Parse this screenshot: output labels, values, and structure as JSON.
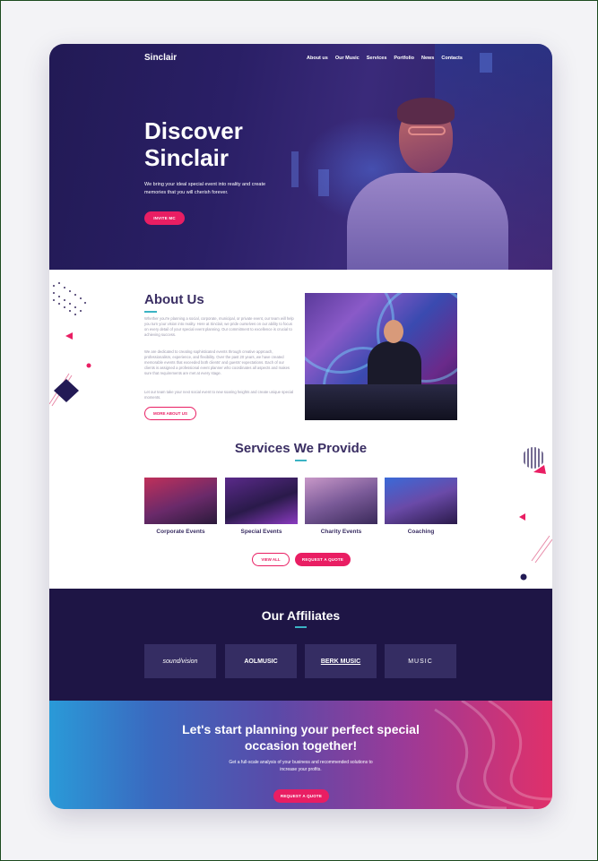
{
  "brand": "Sinclair",
  "nav": [
    "About us",
    "Our Music",
    "Services",
    "Portfolio",
    "News",
    "Contacts"
  ],
  "hero": {
    "title_line1": "Discover",
    "title_line2": "Sinclair",
    "subtitle": "We bring your ideal special event into reality and create memories that you will cherish forever.",
    "cta": "INVITE MC"
  },
  "about": {
    "title": "About Us",
    "para1": "Whether you're planning a social, corporate, municipal, or private event, our team will help you turn your vision into reality. Here at Sinclair, we pride ourselves on our ability to focus on every detail of your special event planning. Our commitment to excellence is crucial to achieving success.",
    "para2": "We are dedicated to creating sophisticated events through creative approach, professionalism, experience, and flexibility. Over the past 20 years, we have created memorable events that exceeded both clients' and guests' expectations. Each of our clients is assigned a professional event planner who coordinates all aspects and makes sure that requirements are met at every stage.",
    "para3": "Let our team take your next social event to new soaring heights and create unique special moments.",
    "button": "MORE ABOUT US"
  },
  "services": {
    "title": "Services We Provide",
    "items": [
      "Corporate Events",
      "Special Events",
      "Charity Events",
      "Coaching"
    ],
    "view_all": "VIEW ALL",
    "request": "REQUEST A QUOTE"
  },
  "affiliates": {
    "title": "Our Affiliates",
    "logos": [
      "sound/vision",
      "AOLMUSIC",
      "BERK MUSIC",
      "MUSIC"
    ]
  },
  "cta": {
    "title_line1": "Let's start planning your perfect special",
    "title_line2": "occasion together!",
    "subtitle": "Get a full-scale analysis of your business and recommended solutions to increase your profits.",
    "button": "REQUEST A QUOTE"
  },
  "colors": {
    "accent": "#e91e63",
    "heading": "#3a2e63",
    "dark": "#1e1545",
    "teal": "#3bb3c4"
  }
}
